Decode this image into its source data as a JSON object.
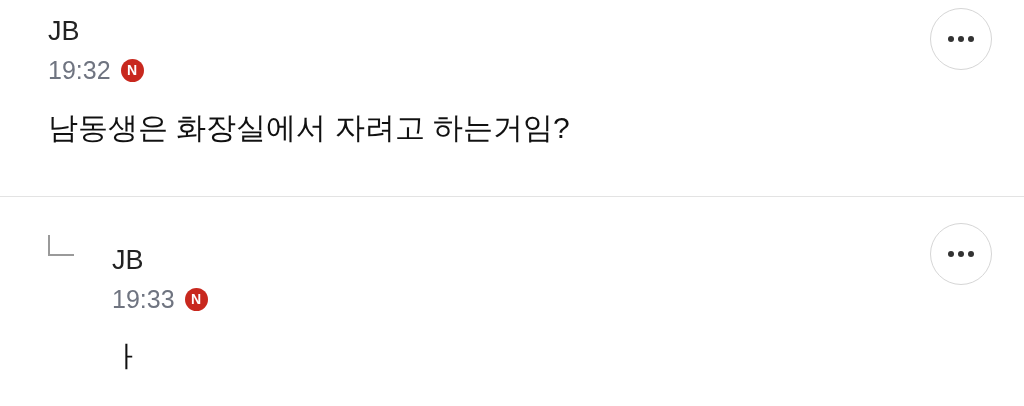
{
  "comments": [
    {
      "author": "JB",
      "time": "19:32",
      "badge": "N",
      "text": "남동생은 화장실에서 자려고 하는거임?",
      "reply": false
    },
    {
      "author": "JB",
      "time": "19:33",
      "badge": "N",
      "text": "ㅏ",
      "reply": true
    }
  ]
}
